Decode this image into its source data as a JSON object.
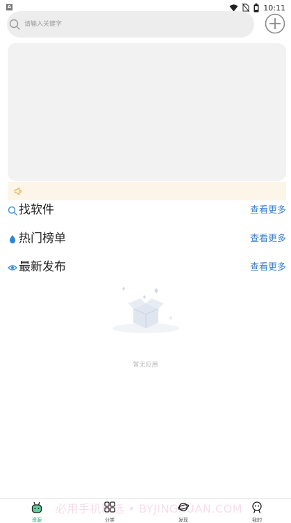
{
  "status": {
    "time": "10:11",
    "left_badge": "A"
  },
  "search": {
    "placeholder": "请输入关键字"
  },
  "sections": [
    {
      "title": "找软件",
      "more": "查看更多",
      "icon": "search-icon"
    },
    {
      "title": "热门榜单",
      "more": "查看更多",
      "icon": "drop-icon"
    },
    {
      "title": "最新发布",
      "more": "查看更多",
      "icon": "eye-icon"
    }
  ],
  "empty": {
    "text": "暂无应用"
  },
  "nav": [
    {
      "label": "资源",
      "active": true
    },
    {
      "label": "分类",
      "active": false
    },
    {
      "label": "发现",
      "active": false
    },
    {
      "label": "我的",
      "active": false
    }
  ],
  "watermark": "必用手机精选 • BYJINGXUAN.COM",
  "colors": {
    "accent": "#3a7fcf",
    "nav_active": "#1f9d6b",
    "notice_bg": "#fdf5e7"
  }
}
